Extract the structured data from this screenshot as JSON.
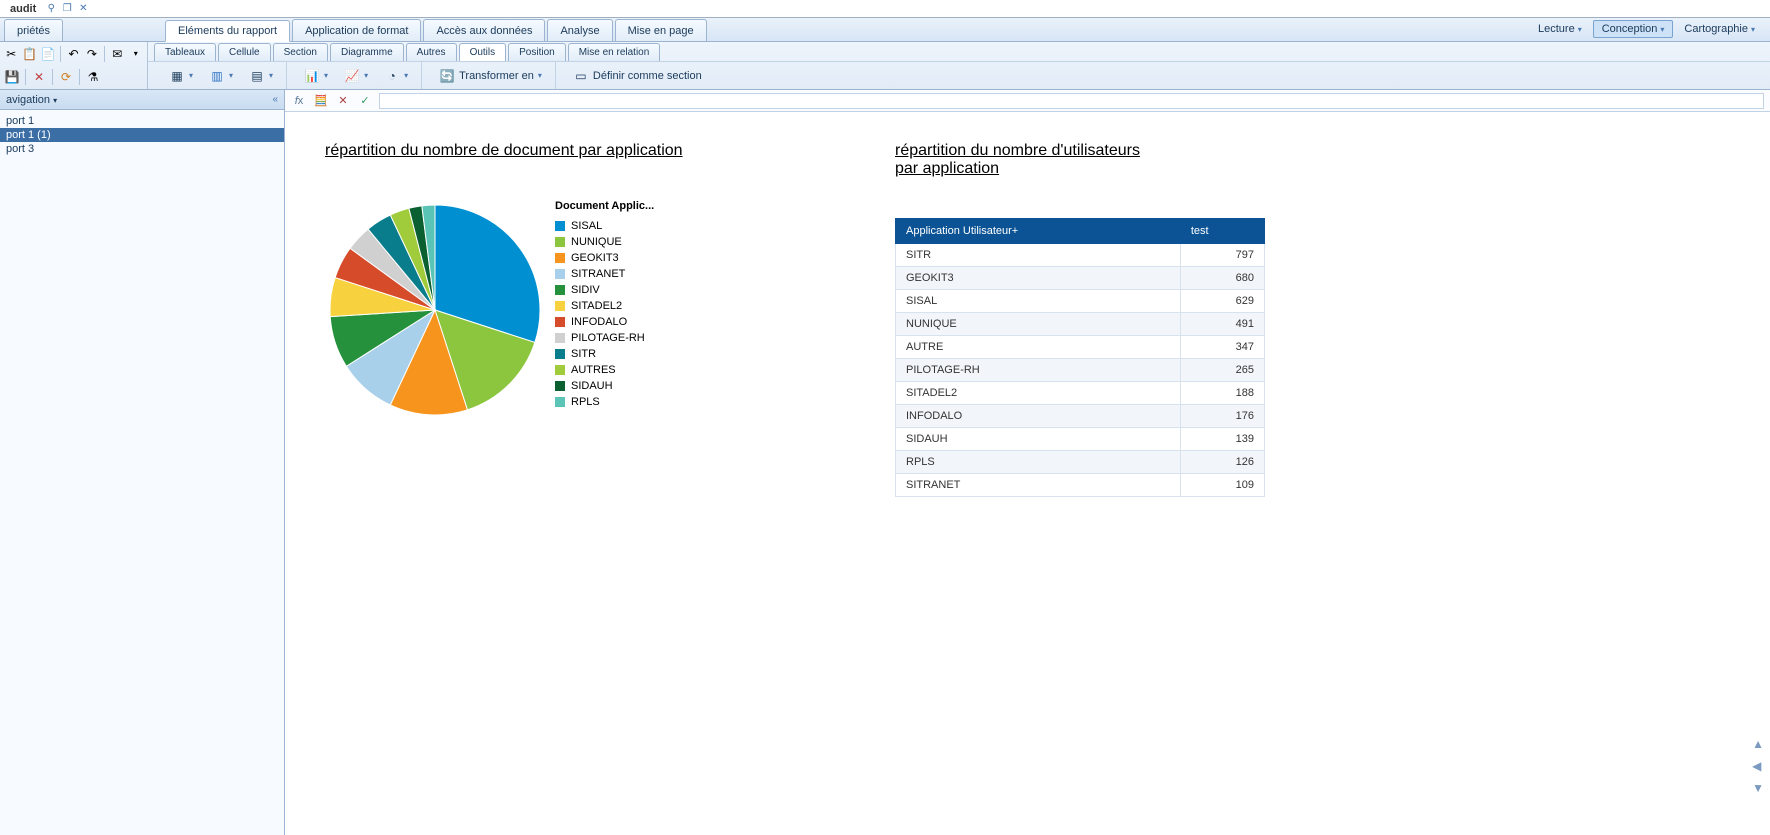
{
  "doc_title": "audit",
  "side_tab": "priétés",
  "main_tabs": [
    {
      "label": "Eléments du rapport",
      "active": true
    },
    {
      "label": "Application de format"
    },
    {
      "label": "Accès aux données"
    },
    {
      "label": "Analyse"
    },
    {
      "label": "Mise en page"
    }
  ],
  "mode_buttons": [
    {
      "label": "Lecture"
    },
    {
      "label": "Conception",
      "active": true
    },
    {
      "label": "Cartographie"
    }
  ],
  "sub_tabs": [
    {
      "label": "Tableaux"
    },
    {
      "label": "Cellule"
    },
    {
      "label": "Section"
    },
    {
      "label": "Diagramme"
    },
    {
      "label": "Autres"
    },
    {
      "label": "Outils",
      "active": true
    },
    {
      "label": "Position"
    },
    {
      "label": "Mise en relation"
    }
  ],
  "tool_buttons": {
    "transformer": "Transformer en",
    "definir": "Définir comme section"
  },
  "nav": {
    "header": "avigation",
    "items": [
      {
        "label": "port 1"
      },
      {
        "label": "port 1 (1)",
        "selected": true
      },
      {
        "label": "port 3"
      }
    ]
  },
  "report": {
    "chart_title": "répartition du nombre de document par application",
    "table_title_l1": "répartition du nombre d'utilisateurs",
    "table_title_l2": " par application",
    "legend_title": "Document Applic...",
    "table_headers": {
      "col1": "Application Utilisateur+",
      "col2": "test"
    },
    "table_rows": [
      {
        "name": "SITR",
        "value": 797
      },
      {
        "name": "GEOKIT3",
        "value": 680
      },
      {
        "name": "SISAL",
        "value": 629
      },
      {
        "name": "NUNIQUE",
        "value": 491
      },
      {
        "name": "AUTRE",
        "value": 347
      },
      {
        "name": "PILOTAGE-RH",
        "value": 265
      },
      {
        "name": "SITADEL2",
        "value": 188
      },
      {
        "name": "INFODALO",
        "value": 176
      },
      {
        "name": "SIDAUH",
        "value": 139
      },
      {
        "name": "RPLS",
        "value": 126
      },
      {
        "name": "SITRANET",
        "value": 109
      }
    ]
  },
  "chart_data": {
    "type": "pie",
    "title": "répartition du nombre de document par application",
    "legend_title": "Document Applic...",
    "series": [
      {
        "name": "SISAL",
        "value": 30,
        "color": "#0090d2"
      },
      {
        "name": "NUNIQUE",
        "value": 15,
        "color": "#8cc63f"
      },
      {
        "name": "GEOKIT3",
        "value": 12,
        "color": "#f7941e"
      },
      {
        "name": "SITRANET",
        "value": 9,
        "color": "#a8d0ea"
      },
      {
        "name": "SIDIV",
        "value": 8,
        "color": "#26913c"
      },
      {
        "name": "SITADEL2",
        "value": 6,
        "color": "#f7d23e"
      },
      {
        "name": "INFODALO",
        "value": 5,
        "color": "#d64b2a"
      },
      {
        "name": "PILOTAGE-RH",
        "value": 4,
        "color": "#d0d0d0"
      },
      {
        "name": "SITR",
        "value": 4,
        "color": "#0a7d8c"
      },
      {
        "name": "AUTRES",
        "value": 3,
        "color": "#a0cc3c"
      },
      {
        "name": "SIDAUH",
        "value": 2,
        "color": "#0a6030"
      },
      {
        "name": "RPLS",
        "value": 2,
        "color": "#5ac5b6"
      }
    ]
  }
}
